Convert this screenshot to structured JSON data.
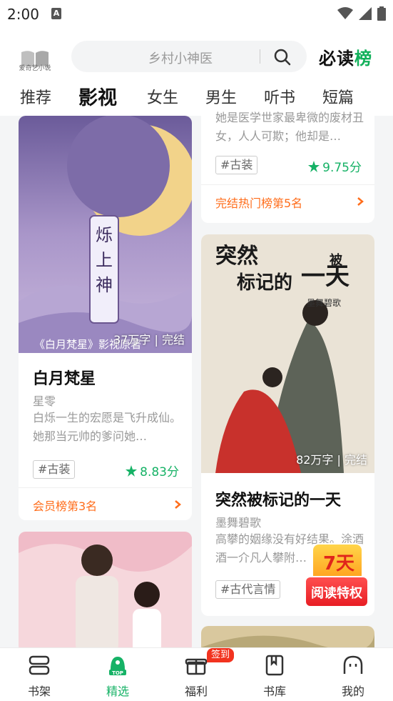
{
  "status_bar": {
    "time": "2:00",
    "notification_icon": "A"
  },
  "header": {
    "logo_text": "爱奇艺小说",
    "search_placeholder": "乡村小神医",
    "ranking_brand_prefix": "必读",
    "ranking_brand_suffix": "榜"
  },
  "tabs": [
    {
      "label": "推荐",
      "active": false
    },
    {
      "label": "影视",
      "active": true
    },
    {
      "label": "女生",
      "active": false
    },
    {
      "label": "男生",
      "active": false
    },
    {
      "label": "听书",
      "active": false
    },
    {
      "label": "短篇",
      "active": false
    }
  ],
  "left_column": [
    {
      "cover_title": "《白月梵星》影视原著",
      "cover_tag": "37万字 | 完结",
      "title": "白月梵星",
      "author": "星零",
      "desc": "白烁一生的宏愿是飞升成仙。她那当元帅的爹问她…",
      "genre": "#古装",
      "score": "8.83分",
      "rank": "会员榜第3名"
    }
  ],
  "right_column": [
    {
      "desc": "她是医学世家最卑微的废材丑女，人人可欺；他却是…",
      "genre": "#古装",
      "score": "9.75分",
      "rank": "完结热门榜第5名"
    },
    {
      "cover_title": "突然被标记的一天",
      "cover_author": "墨舞碧歌",
      "cover_tag": "82万字 | 完结",
      "title": "突然被标记的一天",
      "author": "墨舞碧歌",
      "desc": "高攀的姻缘没有好结果。涂酒酒一介凡人攀附…",
      "genre": "#古代言情"
    }
  ],
  "promo": {
    "days": "7天",
    "text": "阅读特权"
  },
  "bottom_nav": [
    {
      "label": "书架",
      "icon": "bookshelf-icon",
      "active": false
    },
    {
      "label": "精选",
      "icon": "top-rank-icon",
      "active": true
    },
    {
      "label": "福利",
      "icon": "gift-icon",
      "active": false,
      "badge": "签到"
    },
    {
      "label": "书库",
      "icon": "library-icon",
      "active": false
    },
    {
      "label": "我的",
      "icon": "profile-icon",
      "active": false
    }
  ],
  "colors": {
    "accent_green": "#16b266",
    "rank_orange": "#ff6d1b",
    "badge_red": "#f2331f"
  }
}
